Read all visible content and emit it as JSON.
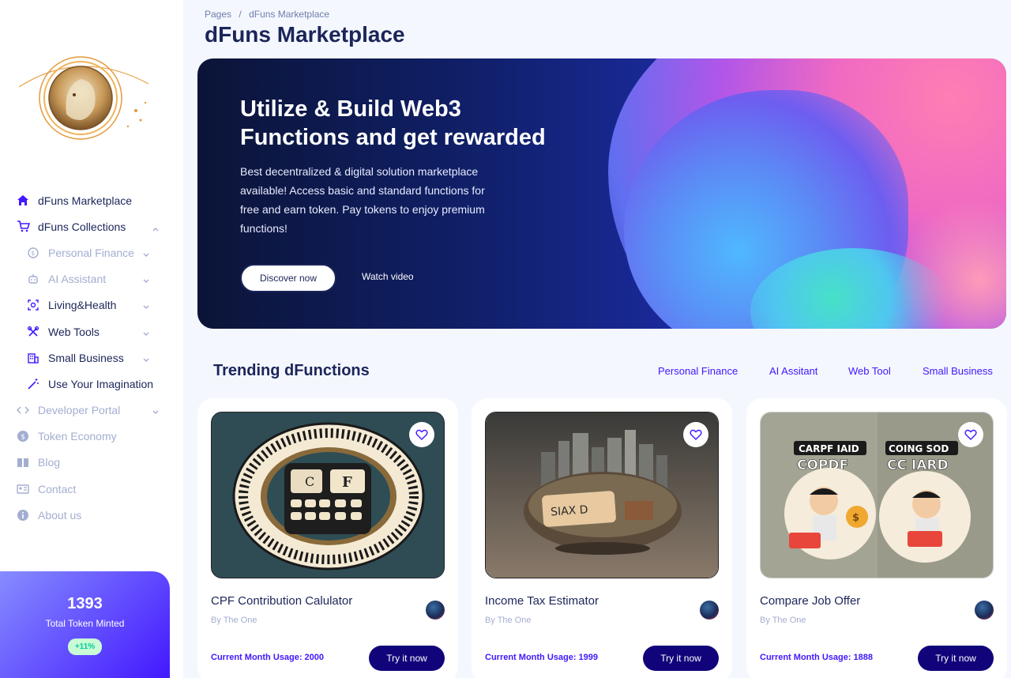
{
  "breadcrumb": {
    "root": "Pages",
    "sep": "/",
    "current": "dFuns Marketplace"
  },
  "page_title": "dFuns Marketplace",
  "sidebar": {
    "items": [
      {
        "label": "dFuns Marketplace",
        "icon": "home-icon"
      },
      {
        "label": "dFuns Collections",
        "icon": "cart-icon",
        "expanded": true
      },
      {
        "label": "Personal Finance",
        "icon": "finance-icon"
      },
      {
        "label": "AI Assistant",
        "icon": "robot-icon"
      },
      {
        "label": "Living&Health",
        "icon": "scan-face-icon"
      },
      {
        "label": "Web Tools",
        "icon": "tools-icon"
      },
      {
        "label": "Small Business",
        "icon": "building-icon"
      },
      {
        "label": "Use Your Imagination",
        "icon": "magic-wand-icon"
      },
      {
        "label": "Developer Portal",
        "icon": "code-icon"
      },
      {
        "label": "Token Economy",
        "icon": "dollar-icon"
      },
      {
        "label": "Blog",
        "icon": "book-icon"
      },
      {
        "label": "Contact",
        "icon": "contact-card-icon"
      },
      {
        "label": "About us",
        "icon": "info-icon"
      }
    ]
  },
  "token_card": {
    "value": "1393",
    "label": "Total Token Minted",
    "change": "+11%"
  },
  "hero": {
    "title": "Utilize & Build Web3 Functions and get rewarded",
    "description": "Best decentralized & digital solution marketplace available! Access basic and standard functions for free and earn token. Pay tokens to enjoy premium functions!",
    "primary_button": "Discover now",
    "secondary_button": "Watch video"
  },
  "trending": {
    "title": "Trending dFunctions",
    "tabs": [
      "Personal Finance",
      "AI Assitant",
      "Web Tool",
      "Small Business"
    ],
    "cards": [
      {
        "title": "CPF Contribution Calulator",
        "author": "By The One",
        "usage": "Current Month Usage: 2000",
        "button": "Try it now"
      },
      {
        "title": "Income Tax Estimator",
        "author": "By The One",
        "usage": "Current Month Usage: 1999",
        "button": "Try it now"
      },
      {
        "title": "Compare Job Offer",
        "author": "By The One",
        "usage": "Current Month Usage: 1888",
        "button": "Try it now"
      }
    ]
  },
  "colors": {
    "brand": "#4318ff",
    "navy": "#11047a",
    "text": "#1b2559",
    "muted": "#a3aed0"
  }
}
